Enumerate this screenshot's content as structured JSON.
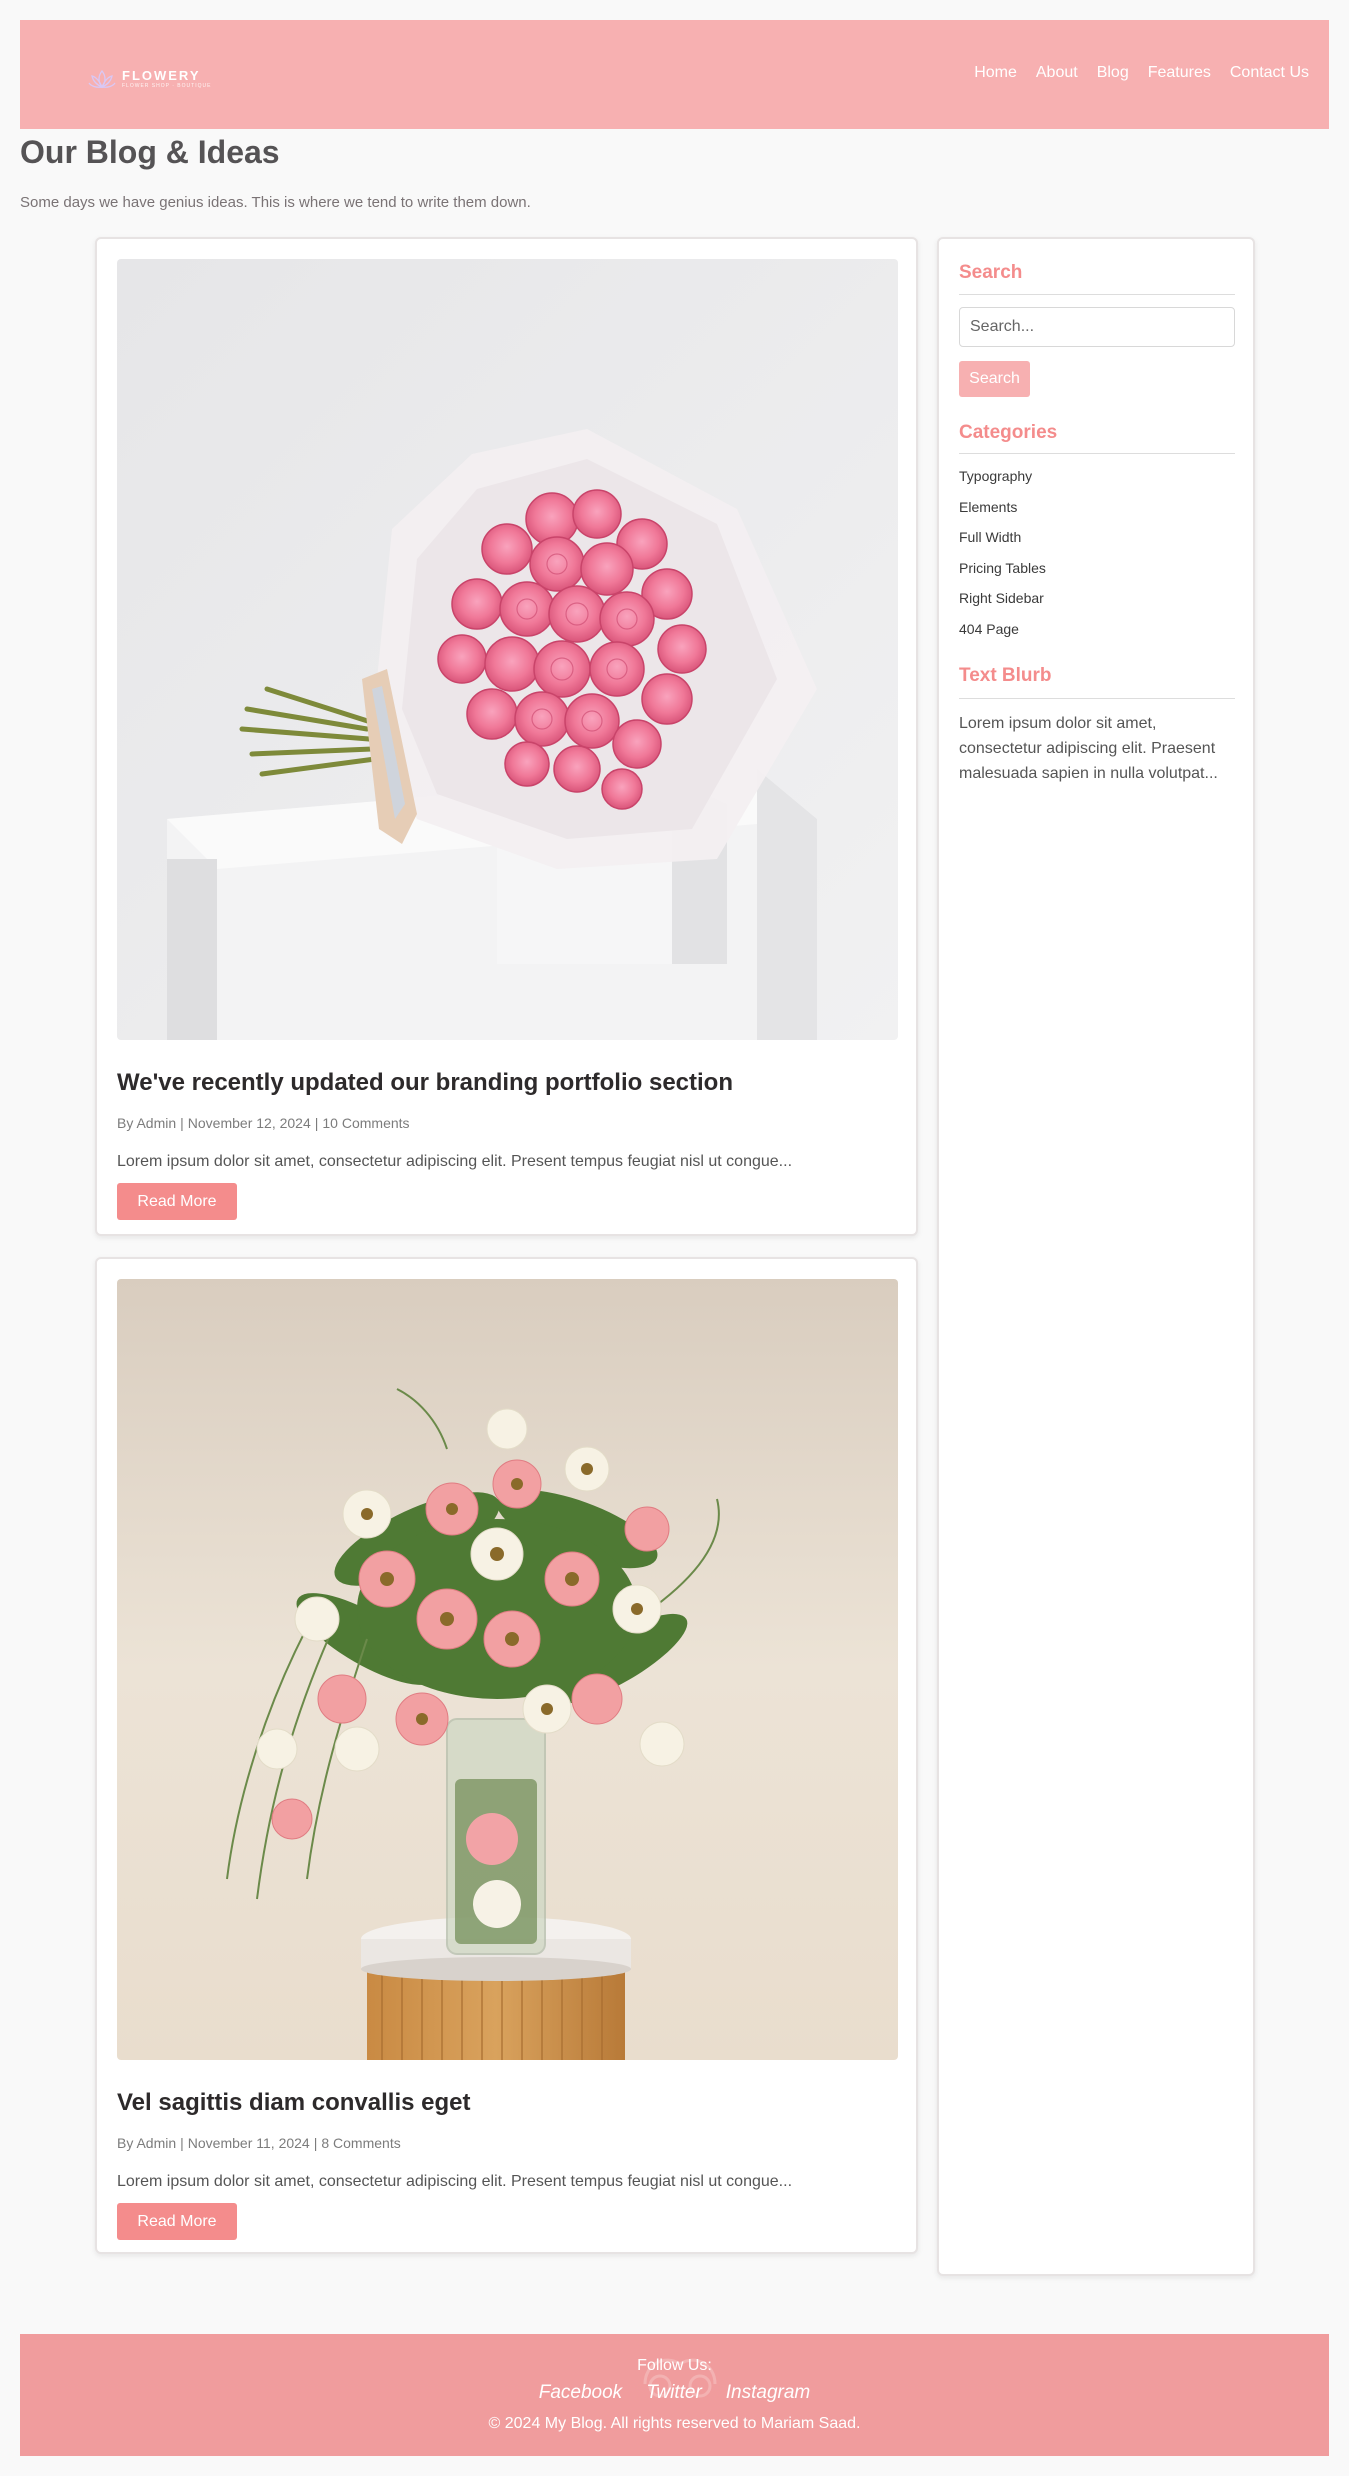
{
  "header": {
    "logo": {
      "name": "FLOWERY",
      "tagline": "FLOWER SHOP · BOUTIQUE"
    },
    "nav": [
      "Home",
      "About",
      "Blog",
      "Features",
      "Contact Us"
    ]
  },
  "page": {
    "title": "Our Blog & Ideas",
    "subtitle": "Some days we have genius ideas. This is where we tend to write them down."
  },
  "posts": [
    {
      "image": "pink-rose-bouquet-photo",
      "title": "We've recently updated our branding portfolio section",
      "author": "By Admin",
      "date": "November 12, 2024",
      "comments": "10 Comments",
      "excerpt": "Lorem ipsum dolor sit amet, consectetur adipiscing elit. Present tempus feugiat nisl ut congue...",
      "button": "Read More"
    },
    {
      "image": "gerbera-vase-arrangement-photo",
      "title": "Vel sagittis diam convallis eget",
      "author": "By Admin",
      "date": "November 11, 2024",
      "comments": "8 Comments",
      "excerpt": "Lorem ipsum dolor sit amet, consectetur adipiscing elit. Present tempus feugiat nisl ut congue...",
      "button": "Read More"
    }
  ],
  "meta_separator": "|",
  "sidebar": {
    "search": {
      "title": "Search",
      "placeholder": "Search...",
      "button": "Search"
    },
    "categories": {
      "title": "Categories",
      "items": [
        "Typography",
        "Elements",
        "Full Width",
        "Pricing Tables",
        "Right Sidebar",
        "404 Page"
      ]
    },
    "blurb": {
      "title": "Text Blurb",
      "text": "Lorem ipsum dolor sit amet, consectetur adipiscing elit. Praesent malesuada sapien in nulla volutpat..."
    }
  },
  "footer": {
    "follow": "Follow Us:",
    "social": [
      "Facebook",
      "Twitter",
      "Instagram"
    ],
    "copyright": "© 2024 My Blog. All rights reserved to Mariam Saad."
  },
  "colors": {
    "header_bg": "#f7b0b1",
    "accent": "#f48c8c",
    "footer_bg": "#f09c9d",
    "page_bg": "#f9f9f9",
    "title_text": "#555355"
  }
}
